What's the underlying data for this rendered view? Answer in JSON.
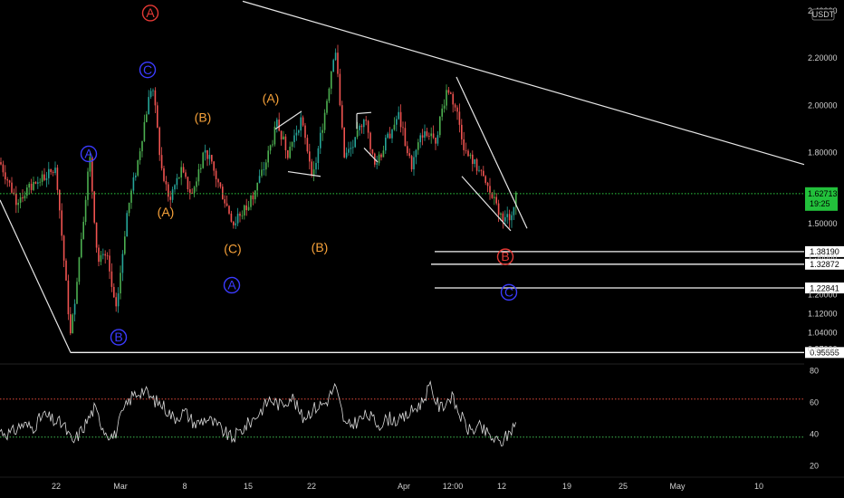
{
  "chart_data": [
    {
      "type": "candlestick",
      "quote_currency": "USDT",
      "x_ticks": [
        "22",
        "Mar",
        "8",
        "15",
        "22",
        "Apr",
        "12:00",
        "12",
        "19",
        "25",
        "May",
        "10"
      ],
      "y_ticks": [
        "2.40000",
        "2.20000",
        "2.00000",
        "1.80000",
        "1.50000",
        "1.36000",
        "1.20000",
        "1.12000",
        "1.04000",
        "0.97000"
      ],
      "ylim": [
        0.93,
        2.43
      ],
      "current_price": {
        "label": "1.62713",
        "value": 1.62713,
        "countdown": "19:25"
      },
      "support_levels": [
        {
          "label": "1.38190",
          "value": 1.3819
        },
        {
          "label": "1.32872",
          "value": 1.32872
        },
        {
          "label": "1.22841",
          "value": 1.22841
        },
        {
          "label": "0.95555",
          "value": 0.95555
        }
      ],
      "price_series": [
        {
          "t": 0,
          "p": 1.76
        },
        {
          "t": 18,
          "p": 1.6
        },
        {
          "t": 42,
          "p": 1.68
        },
        {
          "t": 62,
          "p": 1.73
        },
        {
          "t": 68,
          "p": 1.46
        },
        {
          "t": 78,
          "p": 1.02
        },
        {
          "t": 88,
          "p": 1.38
        },
        {
          "t": 99,
          "p": 1.78
        },
        {
          "t": 108,
          "p": 1.34
        },
        {
          "t": 118,
          "p": 1.36
        },
        {
          "t": 128,
          "p": 1.12
        },
        {
          "t": 140,
          "p": 1.54
        },
        {
          "t": 152,
          "p": 1.76
        },
        {
          "t": 160,
          "p": 1.94
        },
        {
          "t": 168,
          "p": 2.1
        },
        {
          "t": 178,
          "p": 1.74
        },
        {
          "t": 186,
          "p": 1.6
        },
        {
          "t": 200,
          "p": 1.72
        },
        {
          "t": 212,
          "p": 1.62
        },
        {
          "t": 226,
          "p": 1.82
        },
        {
          "t": 240,
          "p": 1.68
        },
        {
          "t": 258,
          "p": 1.5
        },
        {
          "t": 274,
          "p": 1.58
        },
        {
          "t": 292,
          "p": 1.74
        },
        {
          "t": 306,
          "p": 1.92
        },
        {
          "t": 318,
          "p": 1.8
        },
        {
          "t": 332,
          "p": 1.94
        },
        {
          "t": 346,
          "p": 1.7
        },
        {
          "t": 360,
          "p": 2.0
        },
        {
          "t": 370,
          "p": 2.26
        },
        {
          "t": 380,
          "p": 1.78
        },
        {
          "t": 392,
          "p": 1.84
        },
        {
          "t": 402,
          "p": 1.96
        },
        {
          "t": 414,
          "p": 1.74
        },
        {
          "t": 428,
          "p": 1.86
        },
        {
          "t": 440,
          "p": 1.96
        },
        {
          "t": 454,
          "p": 1.74
        },
        {
          "t": 468,
          "p": 1.9
        },
        {
          "t": 480,
          "p": 1.84
        },
        {
          "t": 494,
          "p": 2.08
        },
        {
          "t": 504,
          "p": 1.98
        },
        {
          "t": 514,
          "p": 1.8
        },
        {
          "t": 526,
          "p": 1.74
        },
        {
          "t": 540,
          "p": 1.64
        },
        {
          "t": 552,
          "p": 1.54
        },
        {
          "t": 562,
          "p": 1.52
        },
        {
          "t": 570,
          "p": 1.627
        }
      ],
      "wave_labels": [
        {
          "text": "A",
          "style": "circle",
          "color": "#e53935",
          "t": 166,
          "p": 2.39
        },
        {
          "text": "C",
          "style": "circle",
          "color": "#3b3bff",
          "t": 163,
          "p": 2.15
        },
        {
          "text": "A",
          "style": "circle",
          "color": "#3b3bff",
          "t": 98,
          "p": 1.795
        },
        {
          "text": "B",
          "style": "circle",
          "color": "#3b3bff",
          "t": 131,
          "p": 1.02
        },
        {
          "text": "A",
          "style": "circle",
          "color": "#3b3bff",
          "t": 256,
          "p": 1.24
        },
        {
          "text": "(B)",
          "style": "plain",
          "color": "#f7a23a",
          "t": 224,
          "p": 1.95
        },
        {
          "text": "(A)",
          "style": "plain",
          "color": "#f7a23a",
          "t": 183,
          "p": 1.55
        },
        {
          "text": "(C)",
          "style": "plain",
          "color": "#f7a23a",
          "t": 257,
          "p": 1.395
        },
        {
          "text": "(A)",
          "style": "plain",
          "color": "#f7a23a",
          "t": 299,
          "p": 2.03
        },
        {
          "text": "(B)",
          "style": "plain",
          "color": "#f7a23a",
          "t": 353,
          "p": 1.4
        },
        {
          "text": "B",
          "style": "circle",
          "color": "#e53935",
          "t": 558,
          "p": 1.36
        },
        {
          "text": "C",
          "style": "circle",
          "color": "#3b3bff",
          "t": 562,
          "p": 1.21
        }
      ],
      "trendlines": [
        {
          "t1": 268,
          "p1": 2.44,
          "t2": 888,
          "p2": 1.75
        },
        {
          "t1": 0,
          "p1": 1.6,
          "t2": 78,
          "p2": 0.955
        },
        {
          "t1": 504,
          "p1": 2.12,
          "t2": 582,
          "p2": 1.48
        },
        {
          "t1": 510,
          "p1": 1.7,
          "t2": 564,
          "p2": 1.47
        },
        {
          "t1": 304,
          "p1": 1.9,
          "t2": 333,
          "p2": 1.975
        },
        {
          "t1": 318,
          "p1": 1.72,
          "t2": 354,
          "p2": 1.7
        },
        {
          "t1": 394,
          "p1": 1.965,
          "t2": 410,
          "p2": 1.97
        },
        {
          "t1": 402,
          "p1": 1.82,
          "t2": 417,
          "p2": 1.76
        }
      ]
    },
    {
      "type": "line",
      "indicator": "RSI",
      "y_ticks": [
        "80",
        "60",
        "40",
        "20"
      ],
      "ylim": [
        15,
        83
      ],
      "levels": [
        62,
        38
      ],
      "series": [
        {
          "t": 0,
          "v": 42
        },
        {
          "t": 12,
          "v": 40
        },
        {
          "t": 24,
          "v": 46
        },
        {
          "t": 36,
          "v": 44
        },
        {
          "t": 48,
          "v": 52
        },
        {
          "t": 60,
          "v": 48
        },
        {
          "t": 70,
          "v": 46
        },
        {
          "t": 80,
          "v": 34
        },
        {
          "t": 92,
          "v": 44
        },
        {
          "t": 104,
          "v": 56
        },
        {
          "t": 116,
          "v": 42
        },
        {
          "t": 126,
          "v": 38
        },
        {
          "t": 136,
          "v": 54
        },
        {
          "t": 146,
          "v": 64
        },
        {
          "t": 158,
          "v": 68
        },
        {
          "t": 168,
          "v": 62
        },
        {
          "t": 180,
          "v": 58
        },
        {
          "t": 192,
          "v": 50
        },
        {
          "t": 204,
          "v": 54
        },
        {
          "t": 216,
          "v": 46
        },
        {
          "t": 228,
          "v": 50
        },
        {
          "t": 242,
          "v": 44
        },
        {
          "t": 256,
          "v": 37
        },
        {
          "t": 270,
          "v": 44
        },
        {
          "t": 284,
          "v": 52
        },
        {
          "t": 298,
          "v": 62
        },
        {
          "t": 310,
          "v": 58
        },
        {
          "t": 322,
          "v": 64
        },
        {
          "t": 334,
          "v": 50
        },
        {
          "t": 346,
          "v": 56
        },
        {
          "t": 360,
          "v": 60
        },
        {
          "t": 370,
          "v": 70
        },
        {
          "t": 382,
          "v": 44
        },
        {
          "t": 394,
          "v": 48
        },
        {
          "t": 406,
          "v": 52
        },
        {
          "t": 418,
          "v": 46
        },
        {
          "t": 430,
          "v": 50
        },
        {
          "t": 442,
          "v": 48
        },
        {
          "t": 454,
          "v": 54
        },
        {
          "t": 466,
          "v": 60
        },
        {
          "t": 474,
          "v": 70
        },
        {
          "t": 486,
          "v": 56
        },
        {
          "t": 498,
          "v": 64
        },
        {
          "t": 508,
          "v": 52
        },
        {
          "t": 518,
          "v": 42
        },
        {
          "t": 530,
          "v": 44
        },
        {
          "t": 542,
          "v": 38
        },
        {
          "t": 552,
          "v": 34
        },
        {
          "t": 562,
          "v": 40
        },
        {
          "t": 570,
          "v": 49
        }
      ]
    }
  ],
  "colors": {
    "background": "#000000",
    "candle_up": "#26a69a",
    "candle_down": "#ef5350",
    "candle_up_bright": "#4caf50",
    "current_price_line": "#2ecc40",
    "current_price_tag": "#22c03b",
    "trendline": "#e6e6e6",
    "rsi_line": "#d9d9d9",
    "rsi_upper": "#e0483a",
    "rsi_lower": "#3fb950",
    "grid_text": "#cfcfcf"
  }
}
